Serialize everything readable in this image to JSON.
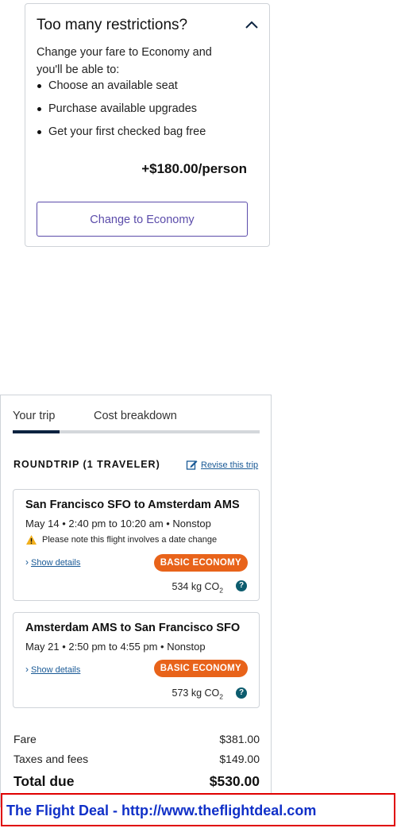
{
  "restrictions": {
    "title": "Too many restrictions?",
    "intro": "Change your fare to Economy and you'll be able to:",
    "benefits": [
      "Choose an available seat",
      "Purchase available upgrades",
      "Get your first checked bag free"
    ],
    "price": "+$180.00/person",
    "button_label": "Change to Economy",
    "toggle_icon": "chevron-up-icon"
  },
  "tabs": [
    {
      "label": "Your trip",
      "active": true
    },
    {
      "label": "Cost breakdown",
      "active": false
    }
  ],
  "trip": {
    "heading": "ROUNDTRIP (1 TRAVELER)",
    "revise_label": "Revise this trip",
    "revise_icon": "edit-icon",
    "flights": [
      {
        "route": "San Francisco SFO to Amsterdam AMS",
        "times": "May 14 • 2:40 pm to 10:20 am • Nonstop",
        "warning": "Please note this flight involves a date change",
        "details_label": "Show details",
        "fare_badge": "BASIC ECONOMY",
        "co2_value": "534 kg CO",
        "co2_sub": "2"
      },
      {
        "route": "Amsterdam AMS to San Francisco SFO",
        "times": "May 21 • 2:50 pm to 4:55 pm • Nonstop",
        "details_label": "Show details",
        "fare_badge": "BASIC ECONOMY",
        "co2_value": "573 kg CO",
        "co2_sub": "2"
      }
    ]
  },
  "costs": {
    "fare_label": "Fare",
    "fare_value": "$381.00",
    "taxes_label": "Taxes and fees",
    "taxes_value": "$149.00",
    "total_label": "Total due",
    "total_value": "$530.00"
  },
  "watermark": "The Flight Deal - http://www.theflightdeal.com",
  "colors": {
    "accent_purple": "#5b4caa",
    "badge_orange": "#e8631a",
    "link_blue": "#1a5a96",
    "tab_active": "#0c2340",
    "watermark_border": "#e00000",
    "watermark_text": "#1030c8"
  }
}
